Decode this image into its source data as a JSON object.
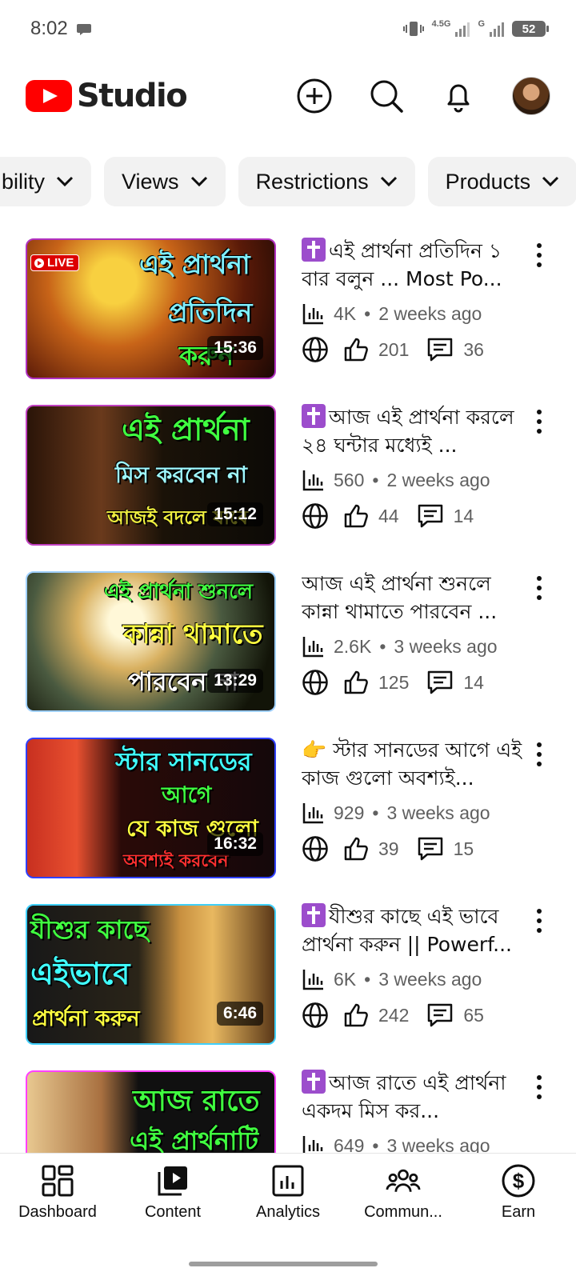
{
  "status_bar": {
    "time": "8:02",
    "network_1": "4.5G",
    "network_2": "G",
    "battery": "52"
  },
  "header": {
    "logo_text": "Studio",
    "icons": [
      "create-icon",
      "search-icon",
      "notifications-icon",
      "account-avatar"
    ]
  },
  "filters": [
    {
      "label": "bility"
    },
    {
      "label": "Views"
    },
    {
      "label": "Restrictions"
    },
    {
      "label": "Products"
    }
  ],
  "videos": [
    {
      "title": "এই প্রার্থনা প্রতিদিন ১ বার বলুন ... Most Po...",
      "has_cross_emoji": true,
      "views": "4K",
      "age": "2 weeks ago",
      "likes": "201",
      "comments": "36",
      "duration": "15:36",
      "live": true,
      "live_label": "LIVE",
      "thumb_lines": [
        "এই প্রার্থনা",
        "প্রতিদিন",
        "করুন"
      ]
    },
    {
      "title": "আজ এই প্রার্থনা করলে ২৪ ঘন্টার মধ্যেই ...",
      "has_cross_emoji": true,
      "views": "560",
      "age": "2 weeks ago",
      "likes": "44",
      "comments": "14",
      "duration": "15:12",
      "thumb_lines": [
        "এই প্রার্থনা",
        "মিস করবেন না",
        "আজই বদলে যাবে"
      ]
    },
    {
      "title": "আজ এই প্রার্থনা শুনলে কান্না থামাতে পারবেন ...",
      "has_cross_emoji": false,
      "views": "2.6K",
      "age": "3 weeks ago",
      "likes": "125",
      "comments": "14",
      "duration": "13:29",
      "thumb_lines": [
        "এই প্রার্থনা শুনলে",
        "কান্না থামাতে",
        "পারবেন না"
      ]
    },
    {
      "title": "👉 স্টার সানডের আগে এই কাজ গুলো অবশ্যই...",
      "has_cross_emoji": false,
      "views": "929",
      "age": "3 weeks ago",
      "likes": "39",
      "comments": "15",
      "duration": "16:32",
      "thumb_lines": [
        "স্টার সানডের",
        "আগে",
        "যে কাজ গুলো",
        "অবশ্যই করবেন"
      ]
    },
    {
      "title": "যীশুর কাছে এই ভাবে প্রার্থনা করুন || Powerf...",
      "has_cross_emoji": true,
      "views": "6K",
      "age": "3 weeks ago",
      "likes": "242",
      "comments": "65",
      "duration": "6:46",
      "thumb_lines": [
        "যীশুর কাছে",
        "এইভাবে",
        "প্রার্থনা করুন"
      ]
    },
    {
      "title": "আজ রাতে এই প্রার্থনা একদম মিস কর...",
      "has_cross_emoji": true,
      "views": "649",
      "age": "3 weeks ago",
      "likes": "",
      "comments": "",
      "duration": "",
      "thumb_lines": [
        "আজ রাতে",
        "এই প্রার্থনাটি"
      ]
    }
  ],
  "bottom_nav": [
    {
      "label": "Dashboard",
      "icon": "dashboard-icon"
    },
    {
      "label": "Content",
      "icon": "content-icon"
    },
    {
      "label": "Analytics",
      "icon": "analytics-icon"
    },
    {
      "label": "Commun...",
      "icon": "community-icon"
    },
    {
      "label": "Earn",
      "icon": "earn-icon"
    }
  ],
  "colors": {
    "brand_red": "#ff0000",
    "text_primary": "#0f0f0f",
    "text_secondary": "#606060",
    "chip_bg": "#f2f2f2"
  }
}
